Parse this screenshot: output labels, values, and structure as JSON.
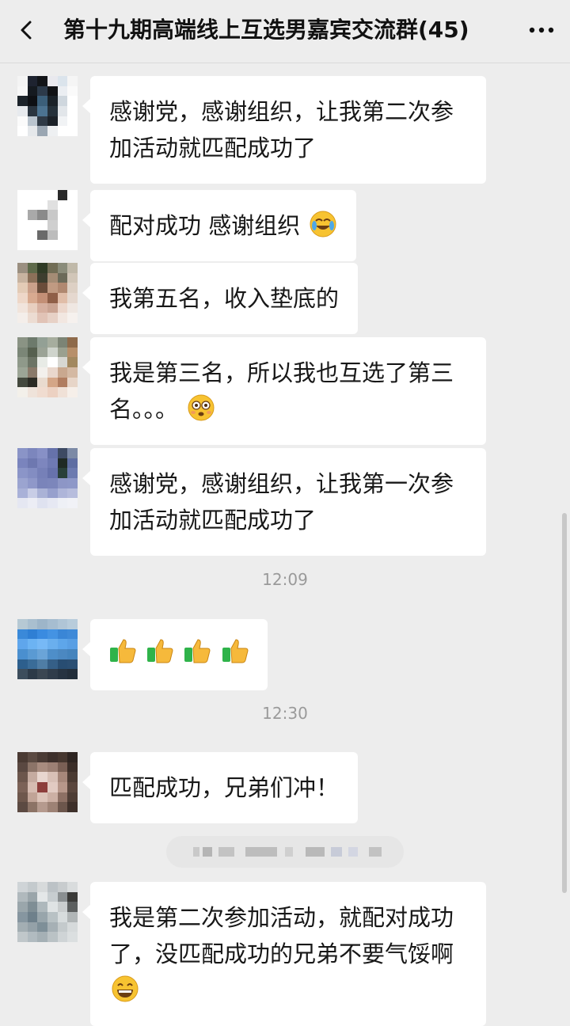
{
  "header": {
    "title": "第十九期高端线上互选男嘉宾交流群(45)",
    "back_icon": "chevron-left-icon",
    "more_icon": "more-dots-icon"
  },
  "messages": [
    {
      "text": "感谢党，感谢组织，让我第二次参加活动就匹配成功了",
      "emoji": ""
    },
    {
      "text": "配对成功 感谢组织",
      "emoji": "crying-laughing-face"
    },
    {
      "text": "我第五名，收入垫底的",
      "emoji": ""
    },
    {
      "text": "我是第三名，所以我也互选了第三名。。。",
      "emoji": "flushed-face"
    },
    {
      "text": "感谢党，感谢组织，让我第一次参加活动就匹配成功了",
      "emoji": ""
    },
    {
      "text": "",
      "emoji": "thumbs-up x4"
    },
    {
      "text": "匹配成功，兄弟们冲！",
      "emoji": ""
    },
    {
      "text": "我是第二次参加活动，就配对成功了，没匹配成功的兄弟不要气馁啊",
      "emoji": "grinning-face"
    }
  ],
  "timestamps": [
    "12:09",
    "12:30"
  ],
  "colors": {
    "background": "#ededed",
    "bubble": "#ffffff",
    "timestamp": "#9a9a9a",
    "thumbs_green": "#2fb34a",
    "thumbs_yellow": "#f6b93b"
  }
}
